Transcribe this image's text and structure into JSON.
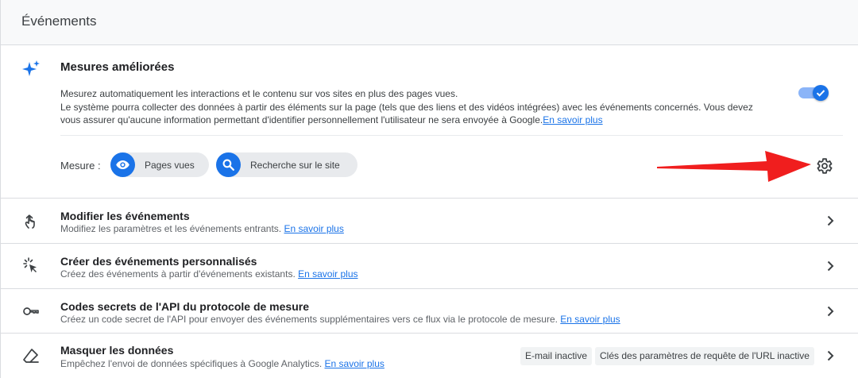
{
  "header": {
    "title": "Événements"
  },
  "enhanced_measurement": {
    "icon": "sparkle-icon",
    "title": "Mesures améliorées",
    "desc_line1": "Mesurez automatiquement les interactions et le contenu sur vos sites en plus des pages vues.",
    "desc_line2": "Le système pourra collecter des données à partir des éléments sur la page (tels que des liens et des vidéos intégrées) avec les événements concernés. Vous devez",
    "desc_line3": "vous assurer qu'aucune information permettant d'identifier personnellement l'utilisateur ne sera envoyée à Google.",
    "learn_more": "En savoir plus",
    "toggle_on": true,
    "toggle_color": "#1a73e8",
    "mesure_label": "Mesure :",
    "chips": [
      {
        "label": "Pages vues",
        "icon": "eye-icon"
      },
      {
        "label": "Recherche sur le site",
        "icon": "search-icon"
      }
    ],
    "settings_icon": "gear-icon",
    "arrow_color": "#f01e1e"
  },
  "rows": [
    {
      "title": "Modifier les événements",
      "subtitle": "Modifiez les paramètres et les événements entrants.",
      "learn_more": "En savoir plus",
      "icon": "touch-icon"
    },
    {
      "title": "Créer des événements personnalisés",
      "subtitle": "Créez des événements à partir d'événements existants.",
      "learn_more": "En savoir plus",
      "icon": "click-sparkle-icon"
    },
    {
      "title": "Codes secrets de l'API du protocole de mesure",
      "subtitle": "Créez un code secret de l'API pour envoyer des événements supplémentaires vers ce flux via le protocole de mesure.",
      "learn_more": "En savoir plus",
      "icon": "key-icon"
    },
    {
      "title": "Masquer les données",
      "subtitle": "Empêchez l'envoi de données spécifiques à Google Analytics.",
      "learn_more": "En savoir plus",
      "icon": "eraser-icon",
      "tags": [
        "E-mail inactive",
        "Clés des paramètres de requête de l'URL inactive"
      ]
    }
  ]
}
